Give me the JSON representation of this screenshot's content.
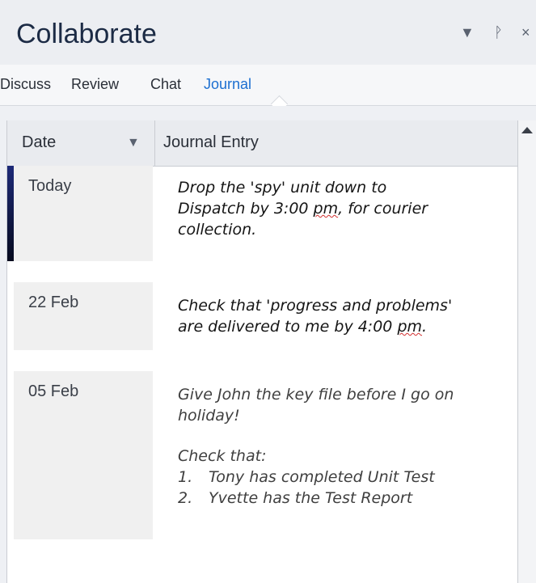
{
  "window": {
    "title": "Collaborate",
    "controls": {
      "dropdown": "▼",
      "pin": "ᚹ",
      "close": "×"
    }
  },
  "tabs": [
    {
      "label": "Discuss",
      "active": false
    },
    {
      "label": "Review",
      "active": false
    },
    {
      "label": "Chat",
      "active": false
    },
    {
      "label": "Journal",
      "active": true
    }
  ],
  "grid": {
    "columns": {
      "date": "Date",
      "entry": "Journal Entry"
    },
    "sort_icon": "▼",
    "rows": [
      {
        "date": "Today",
        "lines": [
          "Drop the 'spy' unit down to",
          "Dispatch by 3:00 ",
          "pm",
          ", for courier",
          "collection."
        ]
      },
      {
        "date": "22 Feb",
        "lines": [
          "Check that 'progress and problems'",
          "are delivered to me by 4:00 ",
          "pm",
          "."
        ]
      },
      {
        "date": "05 Feb",
        "lines": [
          "Give John the key file before I go on",
          "holiday!",
          "Check that:"
        ],
        "list": [
          {
            "num": "1.",
            "text": "Tony has completed Unit Test"
          },
          {
            "num": "2.",
            "text": "Yvette has the Test Report"
          }
        ]
      }
    ]
  },
  "colors": {
    "accent": "#1c6fd1",
    "selection_bar": "#1d2a78",
    "spellcheck": "#d23030"
  }
}
